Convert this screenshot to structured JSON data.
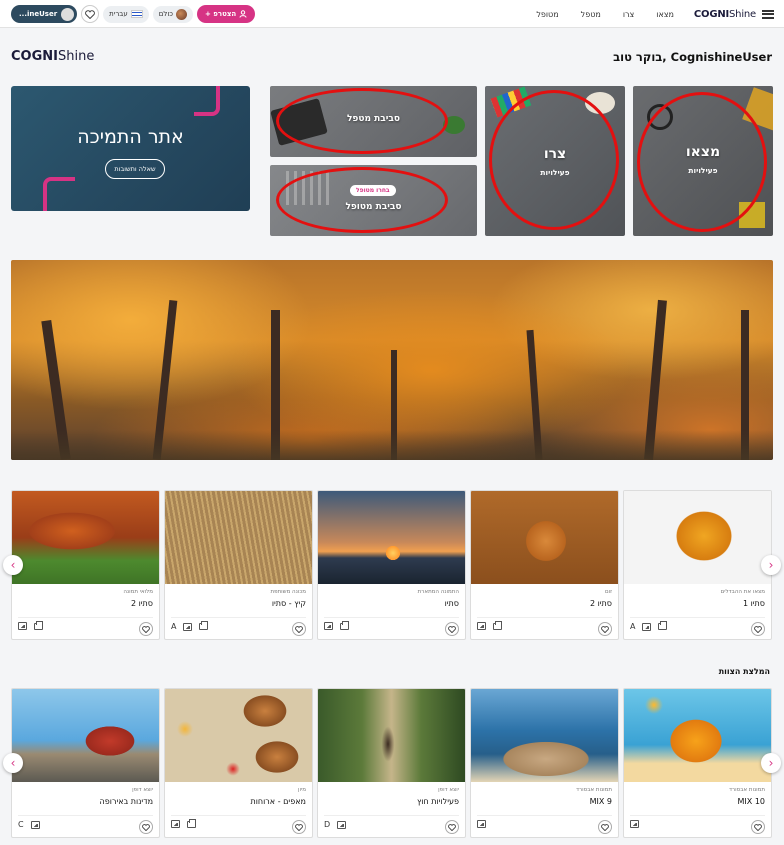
{
  "header": {
    "brand_bold": "COGNI",
    "brand_light": "Shine",
    "nav": [
      "מצאו",
      "צרו",
      "מטפל",
      "מטופל"
    ],
    "user_label": "...ineUser",
    "language": "עברית",
    "world_label": "כולם",
    "join_label": "+ הצטרפ"
  },
  "greeting": "בוקר טוב, CognishineUser",
  "logo": {
    "bold": "COGNI",
    "light": "Shine"
  },
  "support": {
    "title": "אתר התמיכה",
    "button": "שאלה ותשובות"
  },
  "tiles": [
    {
      "title": "מצאו",
      "subtitle": "פעילויות"
    },
    {
      "title": "צרו",
      "subtitle": "פעילויות"
    },
    {
      "title": "סביבת מטפל",
      "subtitle": ""
    },
    {
      "title": "סביבת מטופל",
      "badge": "בחרו מטופל"
    }
  ],
  "carousel1": [
    {
      "sub": "מצאו את ההבדלים",
      "name": "סתיו 1",
      "letter": "A",
      "print": true
    },
    {
      "sub": "זום",
      "name": "סתיו 2",
      "letter": "",
      "print": true
    },
    {
      "sub": "התמונה המתארת",
      "name": "סתיו",
      "letter": "",
      "print": true
    },
    {
      "sub": "מכונה משותפת",
      "name": "קיץ - סתיו",
      "letter": "A",
      "print": true
    },
    {
      "sub": "מלואי תמונה",
      "name": "סתיו 2",
      "letter": "",
      "print": true
    }
  ],
  "recommended_title": "המלצת הצוות",
  "carousel2": [
    {
      "sub": "תמונות אבסורד",
      "name": "MIX 10",
      "letter": "",
      "print": false
    },
    {
      "sub": "תמונות אבסורד",
      "name": "MIX 9",
      "letter": "",
      "print": false
    },
    {
      "sub": "יוצא דופן",
      "name": "פעילויות חוץ",
      "letter": "D",
      "print": false
    },
    {
      "sub": "מיון",
      "name": "מאפים - ארוחות",
      "letter": "",
      "print": true
    },
    {
      "sub": "יוצא דופן",
      "name": "מדינות באירופה",
      "letter": "C",
      "print": false
    }
  ],
  "colors": {
    "accent": "#d63384",
    "support_bg": "#2c5870",
    "ring": "#e31010"
  }
}
